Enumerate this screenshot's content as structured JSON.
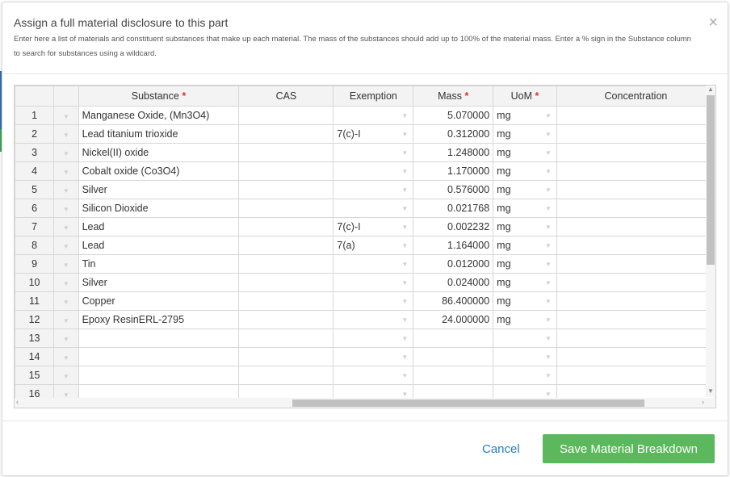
{
  "dialog": {
    "title": "Assign a full material disclosure to this part",
    "subtitle": "Enter here a list of materials and constituent substances that make up each material. The mass of the substances should add up to 100% of the material mass. Enter a % sign in the Substance column to search for substances using a wildcard.",
    "close_glyph": "×"
  },
  "grid": {
    "columns": {
      "substance": "Substance",
      "cas": "CAS",
      "exemption": "Exemption",
      "mass": "Mass",
      "uom": "UoM",
      "concentration": "Concentration"
    },
    "required_mark": "*",
    "rows": [
      {
        "num": "1",
        "substance": "Manganese Oxide, (Mn3O4)",
        "cas": "",
        "exemption": "",
        "mass": "5.070000",
        "uom": "mg",
        "concentration": ""
      },
      {
        "num": "2",
        "substance": "Lead titanium trioxide",
        "cas": "",
        "exemption": "7(c)-I",
        "mass": "0.312000",
        "uom": "mg",
        "concentration": ""
      },
      {
        "num": "3",
        "substance": "Nickel(II) oxide",
        "cas": "",
        "exemption": "",
        "mass": "1.248000",
        "uom": "mg",
        "concentration": ""
      },
      {
        "num": "4",
        "substance": "Cobalt oxide (Co3O4)",
        "cas": "",
        "exemption": "",
        "mass": "1.170000",
        "uom": "mg",
        "concentration": ""
      },
      {
        "num": "5",
        "substance": "Silver",
        "cas": "",
        "exemption": "",
        "mass": "0.576000",
        "uom": "mg",
        "concentration": ""
      },
      {
        "num": "6",
        "substance": "Silicon Dioxide",
        "cas": "",
        "exemption": "",
        "mass": "0.021768",
        "uom": "mg",
        "concentration": ""
      },
      {
        "num": "7",
        "substance": "Lead",
        "cas": "",
        "exemption": "7(c)-I",
        "mass": "0.002232",
        "uom": "mg",
        "concentration": ""
      },
      {
        "num": "8",
        "substance": "Lead",
        "cas": "",
        "exemption": "7(a)",
        "mass": "1.164000",
        "uom": "mg",
        "concentration": ""
      },
      {
        "num": "9",
        "substance": "Tin",
        "cas": "",
        "exemption": "",
        "mass": "0.012000",
        "uom": "mg",
        "concentration": ""
      },
      {
        "num": "10",
        "substance": "Silver",
        "cas": "",
        "exemption": "",
        "mass": "0.024000",
        "uom": "mg",
        "concentration": ""
      },
      {
        "num": "11",
        "substance": "Copper",
        "cas": "",
        "exemption": "",
        "mass": "86.400000",
        "uom": "mg",
        "concentration": ""
      },
      {
        "num": "12",
        "substance": "Epoxy ResinERL-2795",
        "cas": "",
        "exemption": "",
        "mass": "24.000000",
        "uom": "mg",
        "concentration": ""
      },
      {
        "num": "13",
        "substance": "",
        "cas": "",
        "exemption": "",
        "mass": "",
        "uom": "",
        "concentration": ""
      },
      {
        "num": "14",
        "substance": "",
        "cas": "",
        "exemption": "",
        "mass": "",
        "uom": "",
        "concentration": ""
      },
      {
        "num": "15",
        "substance": "",
        "cas": "",
        "exemption": "",
        "mass": "",
        "uom": "",
        "concentration": ""
      },
      {
        "num": "16",
        "substance": "",
        "cas": "",
        "exemption": "",
        "mass": "",
        "uom": "",
        "concentration": ""
      }
    ]
  },
  "footer": {
    "cancel_label": "Cancel",
    "save_label": "Save Material Breakdown"
  },
  "colors": {
    "save_button": "#5cb85c",
    "cancel_link": "#1d7fc4",
    "required_star": "#e0342a"
  }
}
